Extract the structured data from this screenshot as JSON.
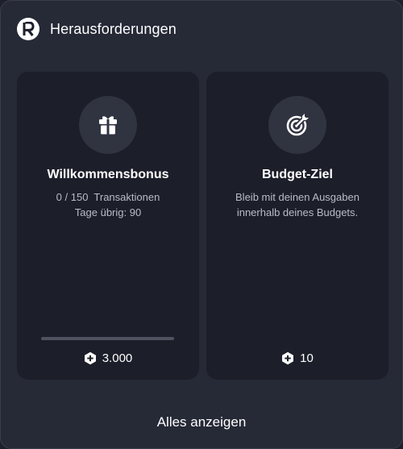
{
  "header": {
    "title": "Herausforderungen",
    "logo_icon": "revolut-r-logo"
  },
  "challenges": [
    {
      "icon": "gift-icon",
      "title": "Willkommensbonus",
      "desc_line1": "0 / 150  Transaktionen",
      "desc_line2": "Tage übrig: 90",
      "progress": 0.0,
      "reward_icon": "hexagon-plus-icon",
      "reward": "3.000"
    },
    {
      "icon": "target-icon",
      "title": "Budget-Ziel",
      "desc_line1": "Bleib mit deinen Ausgaben",
      "desc_line2": "innerhalb deines Budgets.",
      "reward_icon": "hexagon-plus-icon",
      "reward": "10"
    }
  ],
  "footer": {
    "see_all_label": "Alles anzeigen"
  },
  "colors": {
    "background": "#262936",
    "card": "#1c1e29",
    "icon_circle": "#303340",
    "text_primary": "#ffffff",
    "text_secondary": "#b9bcc7"
  }
}
